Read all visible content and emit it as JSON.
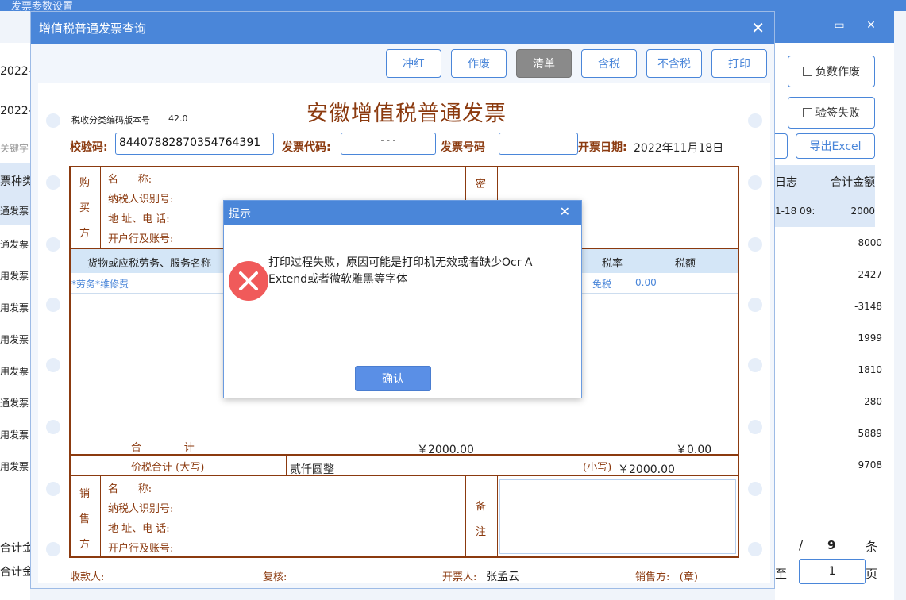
{
  "background_window": {
    "title": "发票参数设置",
    "buttons": {
      "negative_void": "负数作废",
      "verify_fail": "验签失败",
      "export_excel": "导出Excel"
    },
    "left_dates": [
      "2022-1",
      "2022-1"
    ],
    "left_search_placeholder": "关键字",
    "left_header": "票种类",
    "left_rows": [
      "通发票",
      "通发票",
      "用发票",
      "用发票",
      "用发票",
      "用发票",
      "通发票",
      "用发票",
      "用发票"
    ],
    "right_headers": [
      "日志",
      "合计金额"
    ],
    "right_first_log": "1-18 09:",
    "right_amounts": [
      "2000",
      "8000",
      "2427",
      "-3148",
      "1999",
      "1810",
      "280",
      "5889",
      "9708"
    ],
    "summary_labels": [
      "合计金",
      "合计金"
    ],
    "pagination": {
      "slash": "/",
      "total": "9",
      "unit": "条",
      "goto": "至",
      "page": "1",
      "page_unit": "页"
    }
  },
  "dialog": {
    "title": "增值税普通发票查询",
    "toolbar": [
      "冲红",
      "作废",
      "清单",
      "含税",
      "不含税",
      "打印"
    ]
  },
  "invoice": {
    "title": "安徽增值税普通发票",
    "tax_code_version_label": "税收分类编码版本号",
    "tax_code_version": "42.0",
    "check_code_label": "校验码:",
    "check_code": "84407882870354764391",
    "invoice_code_label": "发票代码:",
    "invoice_code": "- - -",
    "invoice_no_label": "发票号码",
    "invoice_no": "",
    "date_label": "开票日期:",
    "date": "2022年11月18日",
    "buyer": [
      "购",
      "买",
      "方"
    ],
    "buyer_fields": [
      "名      称:",
      "纳税人识别号:",
      "地 址、电 话:",
      "开户行及账号:"
    ],
    "mi": "密",
    "goods_header": "货物或应税劳务、服务名称",
    "rate_header": "税率",
    "tax_header": "税额",
    "item_name": "*劳务*维修费",
    "item_rate": "免税",
    "item_tax": "0.00",
    "total_label": "合             计",
    "total_amount": "￥2000.00",
    "total_tax": "￥0.00",
    "price_tax_label": "价税合计 (大写)",
    "price_tax_upper": "贰仟圆整",
    "small_label": "(小写)",
    "price_tax_small": "￥2000.00",
    "seller": [
      "销",
      "售",
      "方"
    ],
    "seller_fields": [
      "名      称:",
      "纳税人识别号:",
      "地 址、电 话:",
      "开户行及账号:"
    ],
    "remark": [
      "备",
      "注"
    ],
    "footer": {
      "payee": "收款人:",
      "reviewer": "复核:",
      "drawer_label": "开票人:",
      "drawer": "张孟云",
      "seller_seal": "销售方:   (章)"
    }
  },
  "prompt": {
    "title": "提示",
    "message": "打印过程失败，原因可能是打印机无效或者缺少Ocr A Extend或者微软雅黑等字体",
    "confirm": "确认"
  }
}
